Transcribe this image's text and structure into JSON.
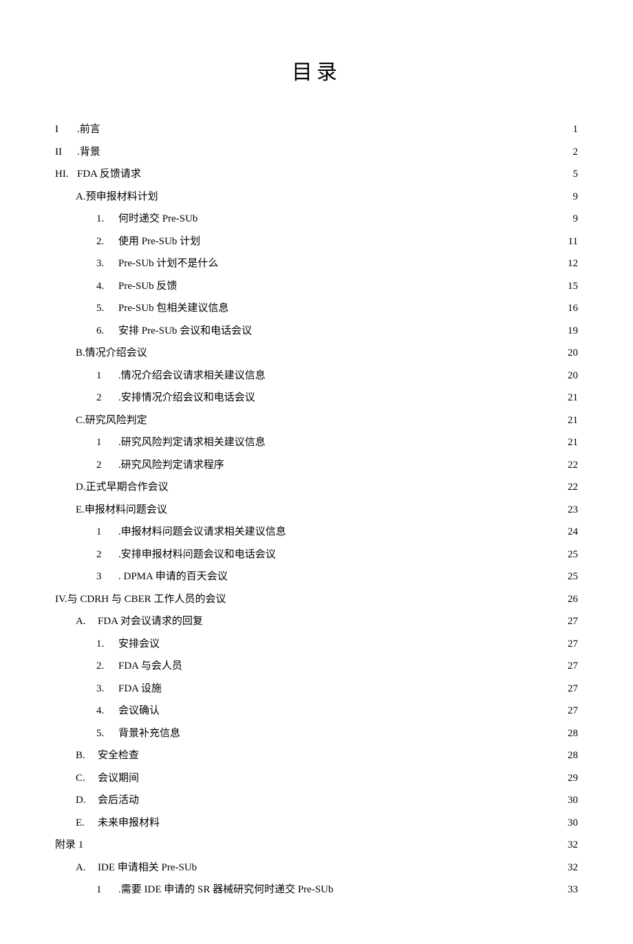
{
  "title": "目录",
  "items": [
    {
      "level": 0,
      "prefix": "I",
      "label": ".前言",
      "page": "1"
    },
    {
      "level": 0,
      "prefix": "II",
      "label": ".背景",
      "page": "2"
    },
    {
      "level": 0,
      "prefix": "HI.",
      "label": "FDA 反馈请求",
      "page": "5"
    },
    {
      "level": 1,
      "prefix": "",
      "label": "A.预申报材料计划",
      "page": "9"
    },
    {
      "level": 2,
      "prefix": "1.",
      "label": "何时递交 Pre-SUb",
      "page": "9",
      "dense": true
    },
    {
      "level": 2,
      "prefix": "2.",
      "label": "使用 Pre-SUb 计划",
      "page": "11"
    },
    {
      "level": 2,
      "prefix": "3.",
      "label": "Pre-SUb 计划不是什么",
      "page": "12"
    },
    {
      "level": 2,
      "prefix": "4.",
      "label": "Pre-SUb 反馈",
      "page": "15"
    },
    {
      "level": 2,
      "prefix": "5.",
      "label": "Pre-SUb 包相关建议信息",
      "page": "16"
    },
    {
      "level": 2,
      "prefix": "6.",
      "label": "安排 Pre-SUb 会议和电话会议",
      "page": "19"
    },
    {
      "level": 1,
      "prefix": "",
      "label": "B.情况介绍会议",
      "page": "20"
    },
    {
      "level": 2,
      "prefix": "1",
      "label": ".情况介绍会议请求相关建议信息",
      "page": "20"
    },
    {
      "level": 2,
      "prefix": "2",
      "label": ".安排情况介绍会议和电话会议",
      "page": "21"
    },
    {
      "level": 1,
      "prefix": "",
      "label": "C.研究风险判定",
      "page": "21"
    },
    {
      "level": 2,
      "prefix": "1",
      "label": ".研究风险判定请求相关建议信息",
      "page": "21"
    },
    {
      "level": 2,
      "prefix": "2",
      "label": ".研究风险判定请求程序",
      "page": "22"
    },
    {
      "level": 1,
      "prefix": "",
      "label": "D.正式早期合作会议",
      "page": "22"
    },
    {
      "level": 1,
      "prefix": "",
      "label": "E.申报材料问题会议",
      "page": "23"
    },
    {
      "level": 2,
      "prefix": "1",
      "label": ".申报材料问题会议请求相关建议信息",
      "page": "24"
    },
    {
      "level": 2,
      "prefix": "2",
      "label": ".安排申报材料问题会议和电话会议",
      "page": "25"
    },
    {
      "level": 2,
      "prefix": "3",
      "label": ". DPMA 申请的百天会议",
      "page": "25"
    },
    {
      "level": 0,
      "prefix": "",
      "label": "IV.与 CDRH 与 CBER 工作人员的会议",
      "page": "26"
    },
    {
      "level": 1,
      "prefix": "A.",
      "label": "FDA 对会议请求的回复",
      "page": "27"
    },
    {
      "level": 2,
      "prefix": "1.",
      "label": "安排会议",
      "page": "27"
    },
    {
      "level": 2,
      "prefix": "2.",
      "label": "FDA 与会人员",
      "page": "27"
    },
    {
      "level": 2,
      "prefix": "3.",
      "label": "FDA 设施",
      "page": "27"
    },
    {
      "level": 2,
      "prefix": "4.",
      "label": "会议确认",
      "page": "27"
    },
    {
      "level": 2,
      "prefix": "5.",
      "label": "背景补充信息",
      "page": "28"
    },
    {
      "level": 1,
      "prefix": "B.",
      "label": "安全检查",
      "page": "28"
    },
    {
      "level": 1,
      "prefix": "C.",
      "label": "会议期间",
      "page": "29"
    },
    {
      "level": 1,
      "prefix": "D.",
      "label": "会后活动",
      "page": "30"
    },
    {
      "level": 1,
      "prefix": "E.",
      "label": "未来申报材料",
      "page": "30"
    },
    {
      "level": 0,
      "prefix": "",
      "label": "附录 1",
      "page": "32",
      "dense": true
    },
    {
      "level": 1,
      "prefix": "A.",
      "label": "IDE 申请相关 Pre-SUb",
      "page": "32",
      "dense": true
    },
    {
      "level": 2,
      "prefix": "1",
      "label": ".需要 IDE 申请的 SR 器械研究何时递交 Pre-SUb",
      "page": "33",
      "dense": true
    }
  ]
}
